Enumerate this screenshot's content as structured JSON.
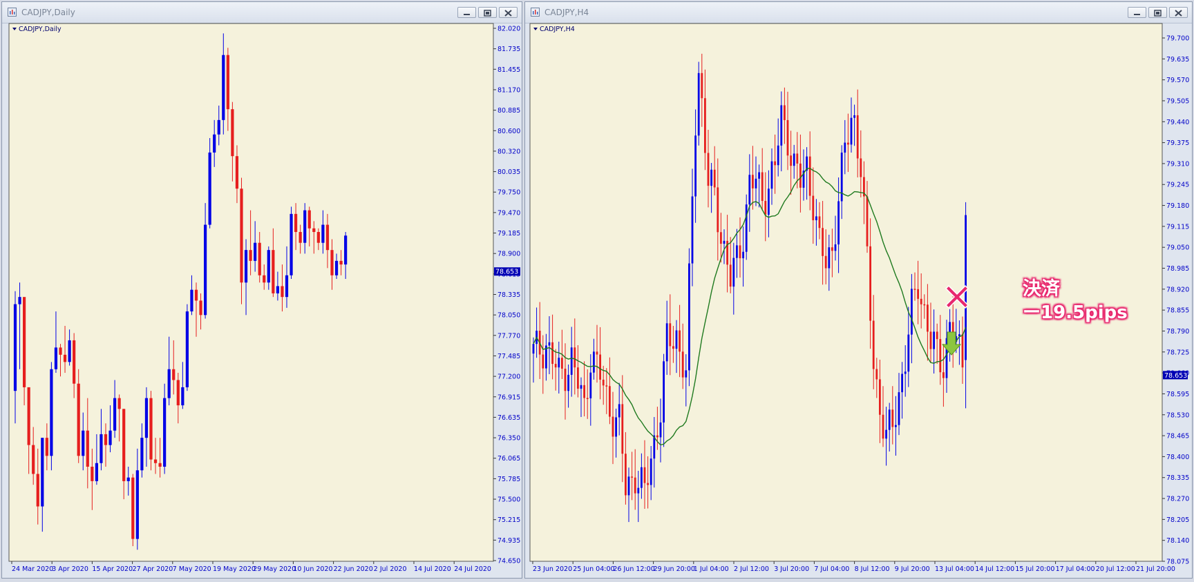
{
  "windows": {
    "left": {
      "title": "CADJPY,Daily",
      "label": "CADJPY,Daily",
      "price_tag": "78.653"
    },
    "right": {
      "title": "CADJPY,H4",
      "label": "CADJPY,H4",
      "price_tag": "78.653"
    }
  },
  "annotation": {
    "line1": "決済",
    "line2": "ー19.5pips"
  },
  "colors": {
    "background": "#f5f2dc",
    "bull": "#0000e6",
    "bear": "#e61e1e",
    "ma": "#1f7a1f",
    "axis_text": "#0000c8",
    "annotation": "#e8286e"
  },
  "chart_data": [
    {
      "type": "candlestick",
      "title": "CADJPY,Daily",
      "ylim": [
        74.65,
        82.02
      ],
      "y_ticks": [
        "82.020",
        "81.735",
        "81.455",
        "81.170",
        "80.885",
        "80.600",
        "80.320",
        "80.035",
        "79.750",
        "79.470",
        "79.185",
        "78.900",
        "78.615",
        "78.335",
        "78.050",
        "77.770",
        "77.485",
        "77.200",
        "76.915",
        "76.635",
        "76.350",
        "76.065",
        "75.785",
        "75.500",
        "75.215",
        "74.935",
        "74.650"
      ],
      "x_ticks": [
        "24 Mar 2020",
        "3 Apr 2020",
        "15 Apr 2020",
        "27 Apr 2020",
        "7 May 2020",
        "19 May 2020",
        "29 May 2020",
        "10 Jun 2020",
        "22 Jun 2020",
        "2 Jul 2020",
        "14 Jul 2020",
        "24 Jul 2020"
      ],
      "last_price": 78.653,
      "candles": [
        [
          77.0,
          78.2,
          78.38,
          76.55
        ],
        [
          78.2,
          78.3,
          78.5,
          77.3
        ],
        [
          78.3,
          77.05,
          78.0,
          76.8
        ],
        [
          77.05,
          76.25,
          77.0,
          75.85
        ],
        [
          76.25,
          75.85,
          76.5,
          75.7
        ],
        [
          75.85,
          75.4,
          76.2,
          75.15
        ],
        [
          75.4,
          76.35,
          76.35,
          75.05
        ],
        [
          76.35,
          76.1,
          76.55,
          75.9
        ],
        [
          76.1,
          77.3,
          77.4,
          75.9
        ],
        [
          77.3,
          77.6,
          78.1,
          77.25
        ],
        [
          77.6,
          77.5,
          77.65,
          77.2
        ],
        [
          77.5,
          77.4,
          77.9,
          77.25
        ],
        [
          77.4,
          77.7,
          77.85,
          77.35
        ],
        [
          77.7,
          77.1,
          77.8,
          76.9
        ],
        [
          77.1,
          76.1,
          77.3,
          76.0
        ],
        [
          76.1,
          76.45,
          76.7,
          75.9
        ],
        [
          76.45,
          75.95,
          76.9,
          75.65
        ],
        [
          75.95,
          75.75,
          76.2,
          75.35
        ],
        [
          75.75,
          76.0,
          76.4,
          75.7
        ],
        [
          76.0,
          76.4,
          76.75,
          75.9
        ],
        [
          76.4,
          76.25,
          76.55,
          75.95
        ],
        [
          76.25,
          76.45,
          76.8,
          76.15
        ],
        [
          76.45,
          76.9,
          77.15,
          76.35
        ],
        [
          76.9,
          76.75,
          76.95,
          76.3
        ],
        [
          76.75,
          75.75,
          76.75,
          75.5
        ],
        [
          75.75,
          75.8,
          75.95,
          75.55
        ],
        [
          75.8,
          74.95,
          75.85,
          74.85
        ],
        [
          74.95,
          75.9,
          76.2,
          74.8
        ],
        [
          75.9,
          76.35,
          76.55,
          75.8
        ],
        [
          76.35,
          76.9,
          77.05,
          75.95
        ],
        [
          76.9,
          76.05,
          77.0,
          75.9
        ],
        [
          76.05,
          76.0,
          76.35,
          75.85
        ],
        [
          76.0,
          75.95,
          76.35,
          75.8
        ],
        [
          75.95,
          76.9,
          77.1,
          75.85
        ],
        [
          76.9,
          77.3,
          77.75,
          76.8
        ],
        [
          77.3,
          77.15,
          77.7,
          76.95
        ],
        [
          77.15,
          76.8,
          77.25,
          76.55
        ],
        [
          76.8,
          77.05,
          77.4,
          76.75
        ],
        [
          77.05,
          78.1,
          78.2,
          77.0
        ],
        [
          78.1,
          78.4,
          78.6,
          78.05
        ],
        [
          78.4,
          78.25,
          78.5,
          77.75
        ],
        [
          78.25,
          78.05,
          78.35,
          77.85
        ],
        [
          78.05,
          79.3,
          79.6,
          78.0
        ],
        [
          79.3,
          80.3,
          80.5,
          79.25
        ],
        [
          80.3,
          80.55,
          80.75,
          80.1
        ],
        [
          80.55,
          80.75,
          80.95,
          80.4
        ],
        [
          80.75,
          81.65,
          81.95,
          80.55
        ],
        [
          81.65,
          80.9,
          81.75,
          80.6
        ],
        [
          80.9,
          80.25,
          81.0,
          79.9
        ],
        [
          80.25,
          79.8,
          80.4,
          79.6
        ],
        [
          79.8,
          78.5,
          79.95,
          78.2
        ],
        [
          78.5,
          78.95,
          79.1,
          78.05
        ],
        [
          78.95,
          78.8,
          79.5,
          78.6
        ],
        [
          78.8,
          79.05,
          79.35,
          78.65
        ],
        [
          79.05,
          78.6,
          79.2,
          78.5
        ],
        [
          78.6,
          78.5,
          78.75,
          78.4
        ],
        [
          78.5,
          78.95,
          79.0,
          78.4
        ],
        [
          78.95,
          78.35,
          79.25,
          78.3
        ],
        [
          78.35,
          78.45,
          78.65,
          78.25
        ],
        [
          78.45,
          78.3,
          78.75,
          78.1
        ],
        [
          78.3,
          78.6,
          79.0,
          78.15
        ],
        [
          78.6,
          79.45,
          79.55,
          78.55
        ],
        [
          79.45,
          79.2,
          79.6,
          78.95
        ],
        [
          79.2,
          79.05,
          79.3,
          78.9
        ],
        [
          79.05,
          79.5,
          79.6,
          78.9
        ],
        [
          79.5,
          79.25,
          79.55,
          79.0
        ],
        [
          79.25,
          79.2,
          79.35,
          78.9
        ],
        [
          79.2,
          79.05,
          79.25,
          78.95
        ],
        [
          79.05,
          79.3,
          79.5,
          78.9
        ],
        [
          79.3,
          78.95,
          79.45,
          78.7
        ],
        [
          78.95,
          78.6,
          79.1,
          78.4
        ],
        [
          78.6,
          78.8,
          78.9,
          78.55
        ],
        [
          78.8,
          78.75,
          78.95,
          78.6
        ],
        [
          78.75,
          79.15,
          79.2,
          78.55
        ]
      ]
    },
    {
      "type": "candlestick",
      "title": "CADJPY,H4",
      "ylim": [
        78.075,
        79.7
      ],
      "y_ticks": [
        "79.700",
        "79.635",
        "79.570",
        "79.505",
        "79.440",
        "79.375",
        "79.310",
        "79.245",
        "79.180",
        "79.115",
        "79.050",
        "78.985",
        "78.920",
        "78.855",
        "78.790",
        "78.725",
        "78.660",
        "78.595",
        "78.530",
        "78.465",
        "78.400",
        "78.335",
        "78.270",
        "78.205",
        "78.140",
        "78.075"
      ],
      "x_ticks": [
        "23 Jun 2020",
        "25 Jun 04:00",
        "26 Jun 12:00",
        "29 Jun 20:00",
        "1 Jul 04:00",
        "2 Jul 12:00",
        "3 Jul 20:00",
        "7 Jul 04:00",
        "8 Jul 12:00",
        "9 Jul 20:00",
        "13 Jul 04:00",
        "14 Jul 12:00",
        "15 Jul 20:00",
        "17 Jul 04:00",
        "20 Jul 12:00",
        "21 Jul 20:00"
      ],
      "last_price": 78.653,
      "ma_period": 20
    }
  ]
}
